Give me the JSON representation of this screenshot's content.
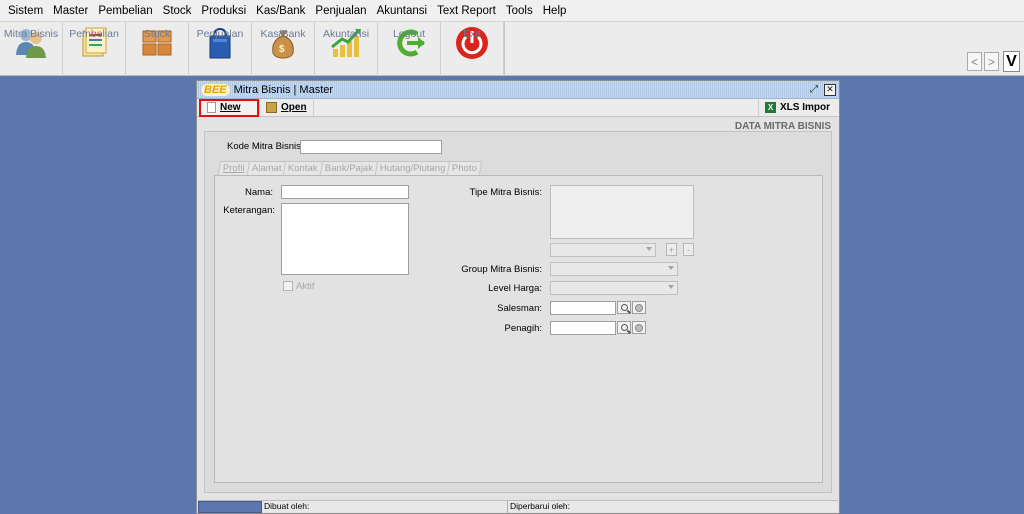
{
  "menu": [
    {
      "label": "Sistem"
    },
    {
      "label": "Master"
    },
    {
      "label": "Pembelian"
    },
    {
      "label": "Stock"
    },
    {
      "label": "Produksi"
    },
    {
      "label": "Kas/Bank"
    },
    {
      "label": "Penjualan"
    },
    {
      "label": "Akuntansi"
    },
    {
      "label": "Text Report"
    },
    {
      "label": "Tools"
    },
    {
      "label": "Help"
    }
  ],
  "toolbar": {
    "buttons": [
      {
        "label": "Mitra Bisnis",
        "icon": "users-icon"
      },
      {
        "label": "Pembelian",
        "icon": "purchase-docs-icon"
      },
      {
        "label": "Stock",
        "icon": "boxes-icon"
      },
      {
        "label": "Penjualan",
        "icon": "shopping-bag-icon"
      },
      {
        "label": "Kas/Bank",
        "icon": "money-bag-icon"
      },
      {
        "label": "Akuntansi",
        "icon": "chart-up-icon"
      },
      {
        "label": "Logout",
        "icon": "logout-arrow-icon"
      },
      {
        "label": "Exit",
        "icon": "power-icon"
      }
    ],
    "nav_prev": "<",
    "nav_next": ">",
    "badge": "V"
  },
  "window": {
    "logo": "BEE",
    "title": "Mitra Bisnis | Master",
    "new_label": "New",
    "open_label": "Open",
    "xls_label": "XLS Impor",
    "section_header": "DATA MITRA BISNIS",
    "kode_label": "Kode Mitra Bisnis:",
    "tabs": [
      "Profil",
      "Alamat",
      "Kontak",
      "Bank/Pajak",
      "Hutang/Piutang",
      "Photo"
    ],
    "form": {
      "nama_label": "Nama:",
      "keterangan_label": "Keterangan:",
      "aktif_label": "Aktif",
      "tipe_label": "Tipe Mitra Bisnis:",
      "add_btn": "+",
      "remove_btn": "-",
      "group_label": "Group Mitra Bisnis:",
      "level_label": "Level Harga:",
      "salesman_label": "Salesman:",
      "penagih_label": "Penagih:"
    },
    "status": {
      "dibuat": "Dibuat oleh:",
      "diperbarui": "Diperbarui oleh:"
    }
  },
  "colors": {
    "desktop": "#5b77ad",
    "highlight": "#e01010"
  }
}
